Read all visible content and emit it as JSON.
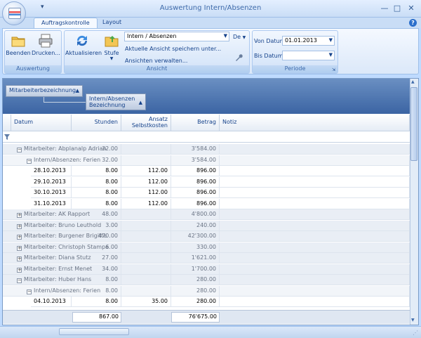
{
  "window": {
    "title": "Auswertung Intern/Absenzen",
    "qat": "▾"
  },
  "tabs": [
    {
      "label": "Auftragskontrolle"
    },
    {
      "label": "Layout"
    }
  ],
  "ribbon": {
    "beenden": "Beenden",
    "drucken": "Drucken...",
    "aktualisieren": "Aktualisieren",
    "stufe": "Stufe",
    "view_select": "Intern / Absenzen",
    "de_label": "De",
    "save_view": "Aktuelle Ansicht speichern unter...",
    "manage_views": "Ansichten verwalten...",
    "von_datum_label": "Von Datum",
    "von_datum_value": "01.01.2013",
    "bis_datum_label": "Bis Datum",
    "bis_datum_value": "",
    "groups": {
      "auswertung": "Auswertung",
      "ansicht": "Ansicht",
      "periode": "Periode"
    }
  },
  "groupbar": {
    "chip1": "Mitarbeiterbezeichnung",
    "chip2a": "Intern/Absenzen",
    "chip2b": "Bezeichnung"
  },
  "columns": {
    "datum": "Datum",
    "stunden": "Stunden",
    "ansatz1": "Ansatz",
    "ansatz2": "Selbstkosten",
    "betrag": "Betrag",
    "notiz": "Notiz"
  },
  "rows": [
    {
      "label": "Mitarbeiter: Abplanalp Adrian",
      "stunden": "32.00",
      "ansatz": "",
      "betrag": "3'584.00",
      "pm": "−"
    },
    {
      "label": "Intern/Absenzen: Ferien",
      "stunden": "32.00",
      "ansatz": "",
      "betrag": "3'584.00",
      "pm": "−"
    },
    {
      "label": "28.10.2013",
      "stunden": "8.00",
      "ansatz": "112.00",
      "betrag": "896.00"
    },
    {
      "label": "29.10.2013",
      "stunden": "8.00",
      "ansatz": "112.00",
      "betrag": "896.00"
    },
    {
      "label": "30.10.2013",
      "stunden": "8.00",
      "ansatz": "112.00",
      "betrag": "896.00"
    },
    {
      "label": "31.10.2013",
      "stunden": "8.00",
      "ansatz": "112.00",
      "betrag": "896.00"
    },
    {
      "label": "Mitarbeiter: AK Rapport",
      "stunden": "48.00",
      "ansatz": "",
      "betrag": "4'800.00",
      "pm": "+"
    },
    {
      "label": "Mitarbeiter: Bruno Leuthold",
      "stunden": "3.00",
      "ansatz": "",
      "betrag": "240.00",
      "pm": "+"
    },
    {
      "label": "Mitarbeiter: Burgener Brigitte",
      "stunden": "470.00",
      "ansatz": "",
      "betrag": "42'300.00",
      "pm": "+"
    },
    {
      "label": "Mitarbeiter: Christoph Stampa",
      "stunden": "6.00",
      "ansatz": "",
      "betrag": "330.00",
      "pm": "+"
    },
    {
      "label": "Mitarbeiter: Diana Stutz",
      "stunden": "27.00",
      "ansatz": "",
      "betrag": "1'621.00",
      "pm": "+"
    },
    {
      "label": "Mitarbeiter: Ernst Menet",
      "stunden": "34.00",
      "ansatz": "",
      "betrag": "1'700.00",
      "pm": "+"
    },
    {
      "label": "Mitarbeiter: Huber Hans",
      "stunden": "8.00",
      "ansatz": "",
      "betrag": "280.00",
      "pm": "−"
    },
    {
      "label": "Intern/Absenzen: Ferien",
      "stunden": "8.00",
      "ansatz": "",
      "betrag": "280.00",
      "pm": "−"
    },
    {
      "label": "04.10.2013",
      "stunden": "8.00",
      "ansatz": "35.00",
      "betrag": "280.00"
    }
  ],
  "totals": {
    "stunden": "867.00",
    "betrag": "76'675.00"
  },
  "colors": {
    "accent": "#15428b",
    "groupbar": "#3b64a3"
  }
}
